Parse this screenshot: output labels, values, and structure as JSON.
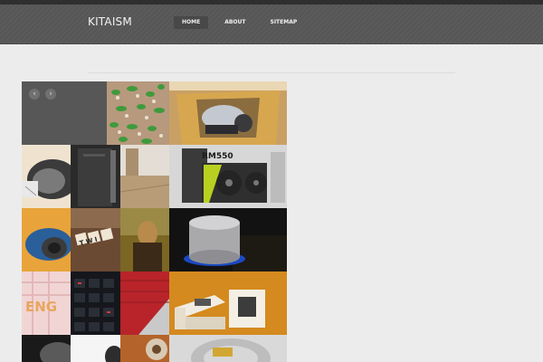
{
  "site": {
    "title": "KITAISM"
  },
  "nav": {
    "items": [
      "HOME",
      "ABOUT",
      "SITEMAP"
    ]
  },
  "slider": {
    "prev_glyph": "‹",
    "next_glyph": "›"
  },
  "tiles": {
    "psu_label": "RM550",
    "scrabble_label": "T W I",
    "blocks_label": "ENG"
  }
}
